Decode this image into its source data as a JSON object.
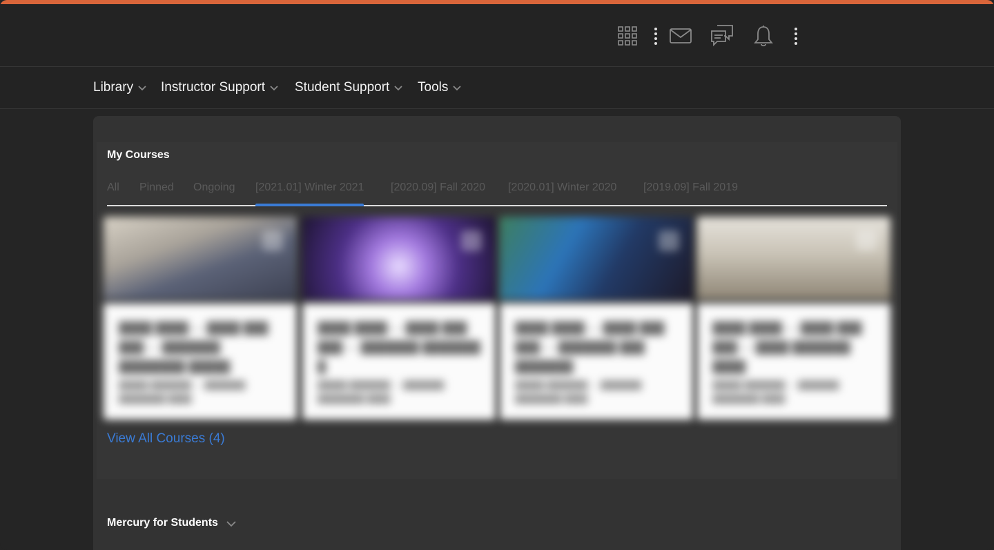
{
  "header": {
    "accent_color": "#d9653a",
    "icons": [
      "apps-grid-icon",
      "more-vertical-icon",
      "mail-icon",
      "chat-icon",
      "bell-icon",
      "more-vertical-icon"
    ]
  },
  "nav": {
    "items": [
      {
        "label": "Library"
      },
      {
        "label": "Instructor Support"
      },
      {
        "label": "Student Support"
      },
      {
        "label": "Tools"
      }
    ]
  },
  "my_courses": {
    "title": "My Courses",
    "tabs": [
      {
        "label": "All"
      },
      {
        "label": "Pinned"
      },
      {
        "label": "Ongoing"
      },
      {
        "label": "[2021.01] Winter 2021",
        "active": true
      },
      {
        "label": "[2020.09] Fall 2020"
      },
      {
        "label": "[2020.01] Winter 2020"
      },
      {
        "label": "[2019.09] Fall 2019"
      }
    ],
    "view_all": "View All Courses (4)",
    "tab_active_color": "#3a7bd5"
  },
  "mercury": {
    "title": "Mercury for Students"
  }
}
